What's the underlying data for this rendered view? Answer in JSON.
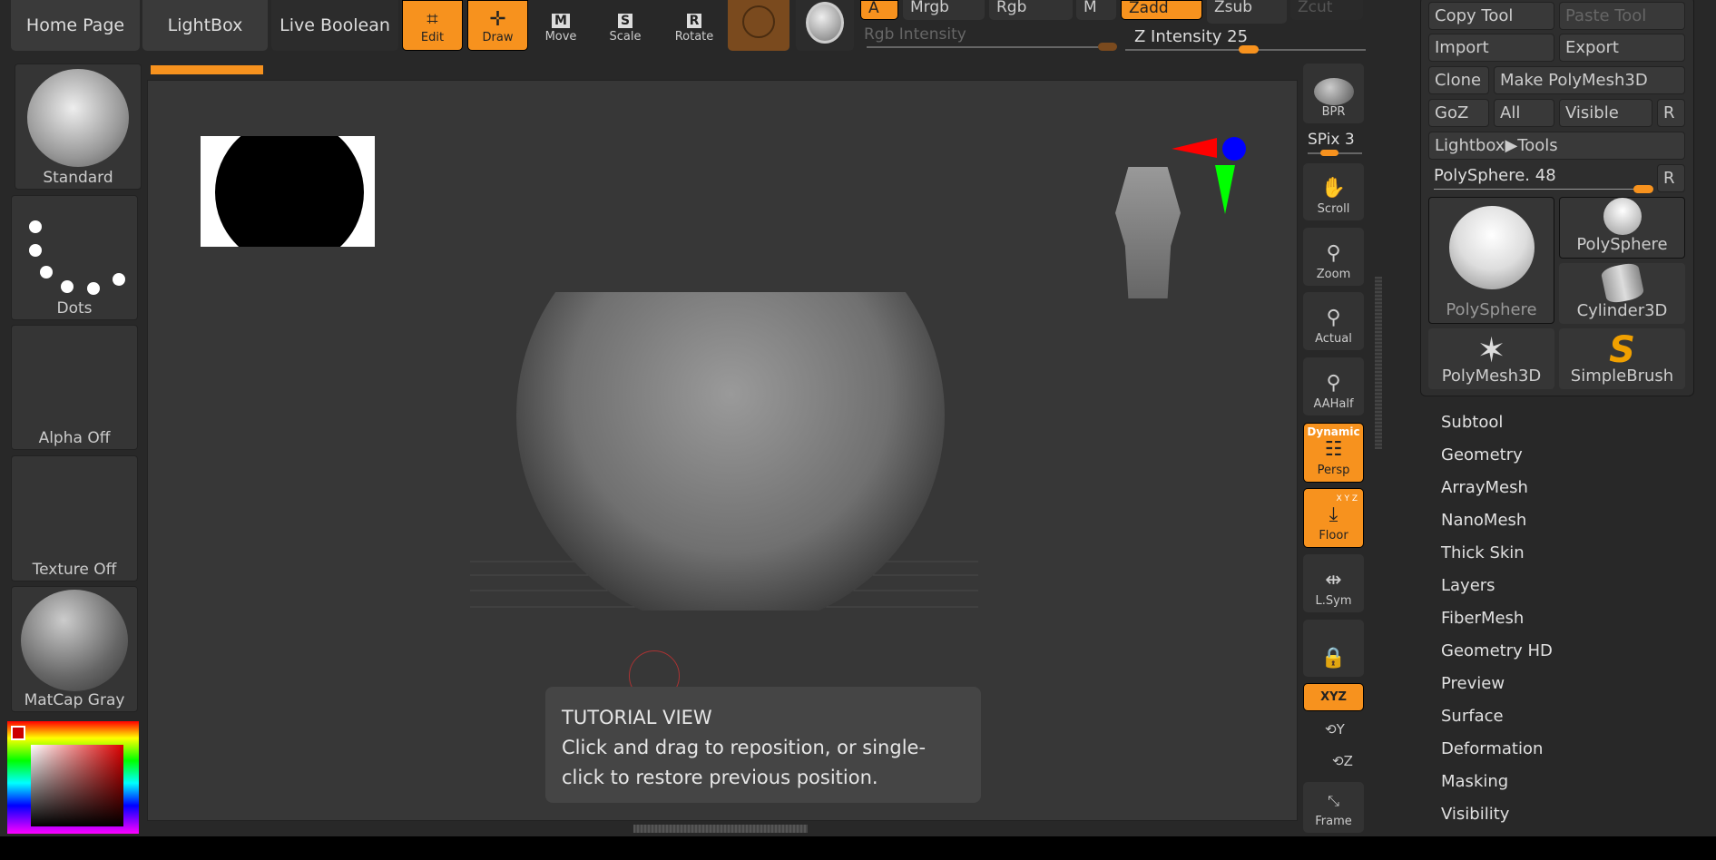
{
  "top": {
    "home": "Home Page",
    "lightbox": "LightBox",
    "live_boolean": "Live Boolean",
    "edit": "Edit",
    "draw": "Draw",
    "move": "Move",
    "scale": "Scale",
    "rotate": "Rotate",
    "a": "A",
    "mrgb": "Mrgb",
    "rgb": "Rgb",
    "m": "M",
    "zadd": "Zadd",
    "zsub": "Zsub",
    "zcut": "Zcut",
    "rgb_intensity": "Rgb Intensity",
    "z_intensity": "Z Intensity 25",
    "z_intensity_value": 25
  },
  "left": {
    "brush": "Standard",
    "stroke": "Dots",
    "alpha": "Alpha Off",
    "texture": "Texture Off",
    "material": "MatCap Gray"
  },
  "shelf": {
    "bpr": "BPR",
    "spix": "SPix 3",
    "scroll": "Scroll",
    "zoom": "Zoom",
    "actual": "Actual",
    "aahalf": "AAHalf",
    "dynamic": "Dynamic",
    "persp": "Persp",
    "floor": "Floor",
    "floor_axes": "X Y Z",
    "lsym": "L.Sym",
    "xyz": "XYZ",
    "y": "Y",
    "z": "Z",
    "frame": "Frame"
  },
  "tutorial": {
    "title": "TUTORIAL VIEW",
    "text": "Click and drag to reposition, or single-click to restore previous position."
  },
  "tool": {
    "copy": "Copy Tool",
    "paste": "Paste Tool",
    "import": "Import",
    "export": "Export",
    "clone": "Clone",
    "make_polymesh": "Make PolyMesh3D",
    "goz": "GoZ",
    "all": "All",
    "visible": "Visible",
    "r": "R",
    "lightbox_tools": "Lightbox▶Tools",
    "current": "PolySphere. 48",
    "current_value": 48,
    "thumbs": [
      "PolySphere",
      "PolySphere",
      "Cylinder3D",
      "PolyMesh3D",
      "SimpleBrush"
    ]
  },
  "menu": [
    "Subtool",
    "Geometry",
    "ArrayMesh",
    "NanoMesh",
    "Thick Skin",
    "Layers",
    "FiberMesh",
    "Geometry HD",
    "Preview",
    "Surface",
    "Deformation",
    "Masking",
    "Visibility"
  ]
}
